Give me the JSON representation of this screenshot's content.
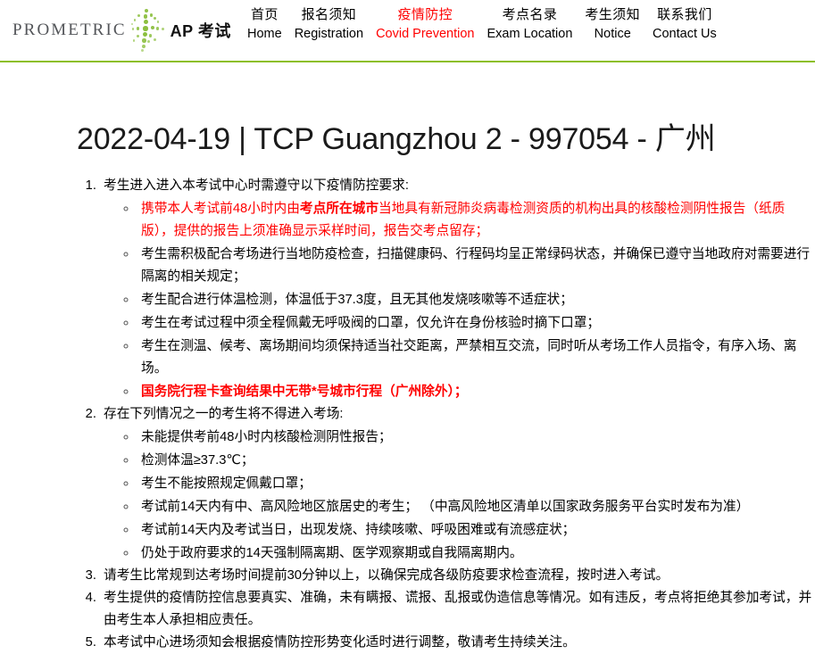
{
  "header": {
    "logo_word": "PROMETRIC",
    "logo_mark": "prometric-starburst-logo",
    "brand_sub": "AP 考试",
    "nav": [
      {
        "cn": "首页",
        "en": "Home",
        "active": false
      },
      {
        "cn": "报名须知",
        "en": "Registration",
        "active": false
      },
      {
        "cn": "疫情防控",
        "en": "Covid Prevention",
        "active": true
      },
      {
        "cn": "考点名录",
        "en": "Exam Location",
        "active": false
      },
      {
        "cn": "考生须知",
        "en": "Notice",
        "active": false
      },
      {
        "cn": "联系我们",
        "en": "Contact Us",
        "active": false
      }
    ],
    "rule_color": "#8cbf26",
    "accent_green": "#8cbf3f",
    "active_color": "#ff0000"
  },
  "page": {
    "title": "2022-04-19 | TCP Guangzhou 2 - 997054 - 广州"
  },
  "content": {
    "items": [
      {
        "number": "1.",
        "text": "考生进入进入本考试中心时需遵守以下疫情防控要求:",
        "sub": [
          {
            "style": "red",
            "parts": [
              {
                "t": "携带本人考试前48小时内由",
                "b": false
              },
              {
                "t": "考点所在城市",
                "b": true
              },
              {
                "t": "当地具有新冠肺炎病毒检测资质的机构出具的核酸检测阴性报告（纸质版），提供的报告上须准确显示采样时间，报告交考点留存；",
                "b": false
              }
            ]
          },
          {
            "style": "plain",
            "parts": [
              {
                "t": "考生需积极配合考场进行当地防疫检查，扫描健康码、行程码均呈正常绿码状态，并确保已遵守当地政府对需要进行隔离的相关规定；",
                "b": false
              }
            ]
          },
          {
            "style": "plain",
            "parts": [
              {
                "t": "考生配合进行体温检测，体温低于37.3度，且无其他发烧咳嗽等不适症状；",
                "b": false
              }
            ]
          },
          {
            "style": "plain",
            "parts": [
              {
                "t": "考生在考试过程中须全程佩戴无呼吸阀的口罩，仅允许在身份核验时摘下口罩；",
                "b": false
              }
            ]
          },
          {
            "style": "plain",
            "parts": [
              {
                "t": "考生在测温、候考、离场期间均须保持适当社交距离，严禁相互交流，同时听从考场工作人员指令，有序入场、离场。",
                "b": false
              }
            ]
          },
          {
            "style": "redbold",
            "parts": [
              {
                "t": "国务院行程卡查询结果中无带*号城市行程（广州除外）；",
                "b": true
              }
            ]
          }
        ]
      },
      {
        "number": "2.",
        "text": "存在下列情况之一的考生将不得进入考场:",
        "sub": [
          {
            "style": "plain",
            "parts": [
              {
                "t": "未能提供考前48小时内核酸检测阴性报告；",
                "b": false
              }
            ]
          },
          {
            "style": "plain",
            "parts": [
              {
                "t": "检测体温≥37.3℃；",
                "b": false
              }
            ]
          },
          {
            "style": "plain",
            "parts": [
              {
                "t": "考生不能按照规定佩戴口罩；",
                "b": false
              }
            ]
          },
          {
            "style": "plain",
            "parts": [
              {
                "t": "考试前14天内有中、高风险地区旅居史的考生； （中高风险地区清单以国家政务服务平台实时发布为准）",
                "b": false
              }
            ]
          },
          {
            "style": "plain",
            "parts": [
              {
                "t": "考试前14天内及考试当日，出现发烧、持续咳嗽、呼吸困难或有流感症状；",
                "b": false
              }
            ]
          },
          {
            "style": "plain",
            "parts": [
              {
                "t": "仍处于政府要求的14天强制隔离期、医学观察期或自我隔离期内。",
                "b": false
              }
            ]
          }
        ]
      },
      {
        "number": "3.",
        "text": "请考生比常规到达考场时间提前30分钟以上，以确保完成各级防疫要求检查流程，按时进入考试。",
        "sub": []
      },
      {
        "number": "4.",
        "text": "考生提供的疫情防控信息要真实、准确，未有瞒报、谎报、乱报或伪造信息等情况。如有违反，考点将拒绝其参加考试，并由考生本人承担相应责任。",
        "sub": []
      },
      {
        "number": "5.",
        "text": "本考试中心进场须知会根据疫情防控形势变化适时进行调整，敬请考生持续关注。",
        "sub": []
      }
    ]
  }
}
